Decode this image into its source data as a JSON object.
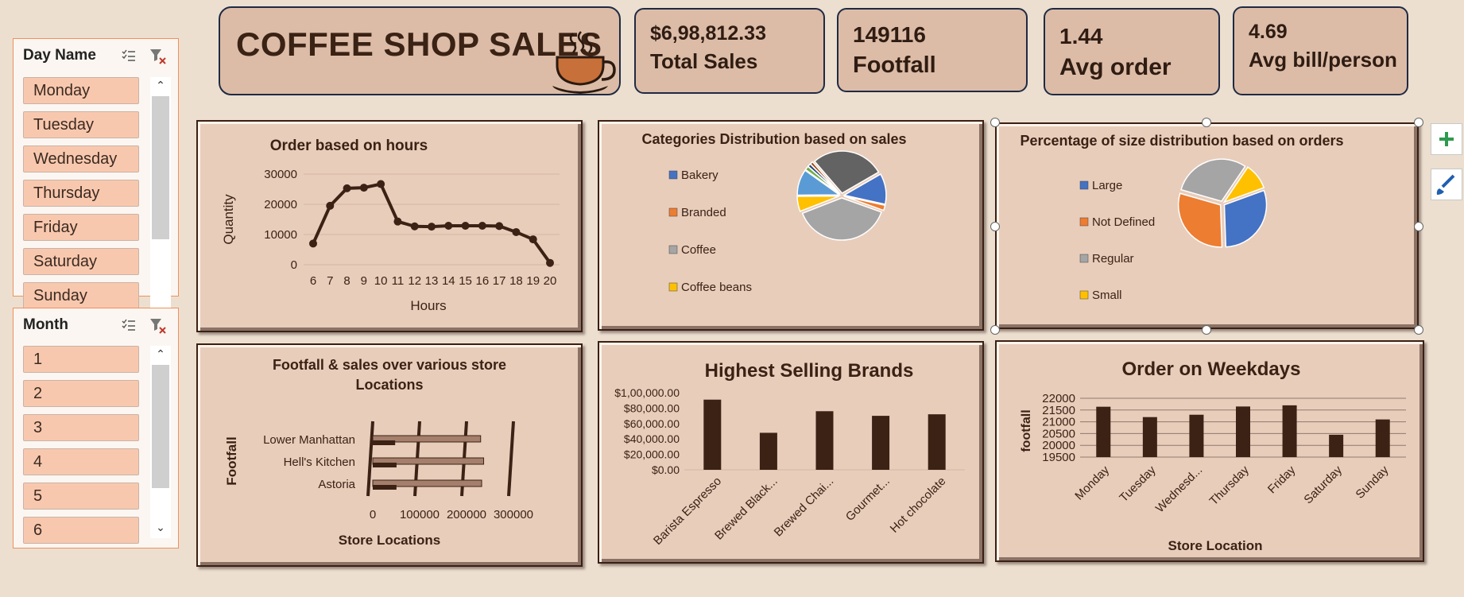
{
  "slicers": {
    "day": {
      "title": "Day Name",
      "items": [
        "Monday",
        "Tuesday",
        "Wednesday",
        "Thursday",
        "Friday",
        "Saturday",
        "Sunday"
      ]
    },
    "month": {
      "title": "Month",
      "items": [
        "1",
        "2",
        "3",
        "4",
        "5",
        "6"
      ]
    }
  },
  "header": {
    "title": "COFFEE SHOP SALES"
  },
  "kpis": {
    "total_sales": {
      "value": "$6,98,812.33",
      "label": "Total Sales"
    },
    "footfall": {
      "value": "149116",
      "label": "Footfall"
    },
    "avg_order": {
      "value": "1.44",
      "label": "Avg order"
    },
    "avg_bill": {
      "value": "4.69",
      "label": "Avg bill/person"
    }
  },
  "colors": {
    "dark_brown": "#3b2214",
    "panel": "#e8cdbb",
    "blue": "#4472c4",
    "orange": "#ed7d31",
    "gray": "#a5a5a5",
    "yellow": "#ffc000",
    "light_blue": "#5b9bd5",
    "dark_gray": "#595959"
  },
  "icons": {
    "coffee": "coffee-cup-icon",
    "multiselect": "multi-select-icon",
    "clear_filter": "clear-filter-icon",
    "add": "plus-icon",
    "style": "brush-icon"
  },
  "chart_data": [
    {
      "id": "hours",
      "type": "line",
      "title": "Order based on hours",
      "xlabel": "Hours",
      "ylabel": "Quantity",
      "x": [
        6,
        7,
        8,
        9,
        10,
        11,
        12,
        13,
        14,
        15,
        16,
        17,
        18,
        19,
        20
      ],
      "values": [
        7000,
        19500,
        25300,
        25500,
        26700,
        14300,
        12700,
        12600,
        12900,
        12900,
        12900,
        12800,
        10800,
        8400,
        600
      ],
      "ylim": [
        0,
        30000
      ],
      "yticks": [
        "30000",
        "20000",
        "10000",
        "0"
      ],
      "grid": true
    },
    {
      "id": "categories",
      "type": "pie",
      "title": "Categories Distribution based on sales",
      "legend": [
        "Bakery",
        "Branded",
        "Coffee",
        "Coffee beans"
      ],
      "slices": [
        {
          "name": "Bakery",
          "value": 11.8,
          "color": "#4472c4"
        },
        {
          "name": "Branded",
          "value": 2.0,
          "color": "#ed7d31"
        },
        {
          "name": "Coffee",
          "value": 38.6,
          "color": "#a5a5a5"
        },
        {
          "name": "Coffee beans",
          "value": 5.8,
          "color": "#ffc000"
        },
        {
          "name": "",
          "value": 10.0,
          "color": "#5b9bd5"
        },
        {
          "name": "",
          "value": 1.5,
          "color": "#70ad47"
        },
        {
          "name": "",
          "value": 1.2,
          "color": "#264478"
        },
        {
          "name": "",
          "value": 1.1,
          "color": "#9e480e"
        },
        {
          "name": "",
          "value": 28.0,
          "color": "#636363"
        }
      ]
    },
    {
      "id": "sizes",
      "type": "pie",
      "title": "Percentage of size distribution based on orders",
      "legend": [
        "Large",
        "Not Defined",
        "Regular",
        "Small"
      ],
      "slices": [
        {
          "name": "Large",
          "value": 30,
          "color": "#4472c4"
        },
        {
          "name": "Not Defined",
          "value": 30,
          "color": "#ed7d31"
        },
        {
          "name": "Regular",
          "value": 30,
          "color": "#a5a5a5"
        },
        {
          "name": "Small",
          "value": 10,
          "color": "#ffc000"
        }
      ]
    },
    {
      "id": "locations",
      "type": "bar",
      "title": "Footfall & sales over various store Locations",
      "title_lines": [
        "Footfall & sales over various store",
        "Locations"
      ],
      "xlabel": "Store Locations",
      "ylabel": "Footfall",
      "categories": [
        "Lower Manhattan",
        "Hell's Kitchen",
        "Astoria"
      ],
      "series": [
        {
          "values": [
            47782,
            50735,
            50599
          ]
        },
        {
          "values": [
            230057,
            236511,
            232244
          ]
        }
      ],
      "xticks": [
        "0",
        "100000",
        "200000",
        "300000"
      ],
      "xlim": [
        0,
        300000
      ]
    },
    {
      "id": "brands",
      "type": "bar",
      "title": "Highest Selling Brands",
      "categories": [
        "Barista Espresso",
        "Brewed Black...",
        "Brewed Chai...",
        "Gourmet...",
        "Hot chocolate"
      ],
      "values": [
        91000,
        48000,
        76000,
        70000,
        72000
      ],
      "ylim": [
        0,
        100000
      ],
      "yticks": [
        "$1,00,000.00",
        "$80,000.00",
        "$60,000.00",
        "$40,000.00",
        "$20,000.00",
        "$0.00"
      ]
    },
    {
      "id": "weekdays",
      "type": "bar",
      "title": "Order on Weekdays",
      "xlabel": "Store Location",
      "ylabel": "footfall",
      "categories": [
        "Monday",
        "Tuesday",
        "Wednesd...",
        "Thursday",
        "Friday",
        "Saturday",
        "Sunday"
      ],
      "values": [
        21640,
        21200,
        21300,
        21650,
        21700,
        20450,
        21100
      ],
      "ylim": [
        19500,
        22000
      ],
      "yticks": [
        "22000",
        "21500",
        "21000",
        "20500",
        "20000",
        "19500"
      ],
      "grid": true
    }
  ]
}
